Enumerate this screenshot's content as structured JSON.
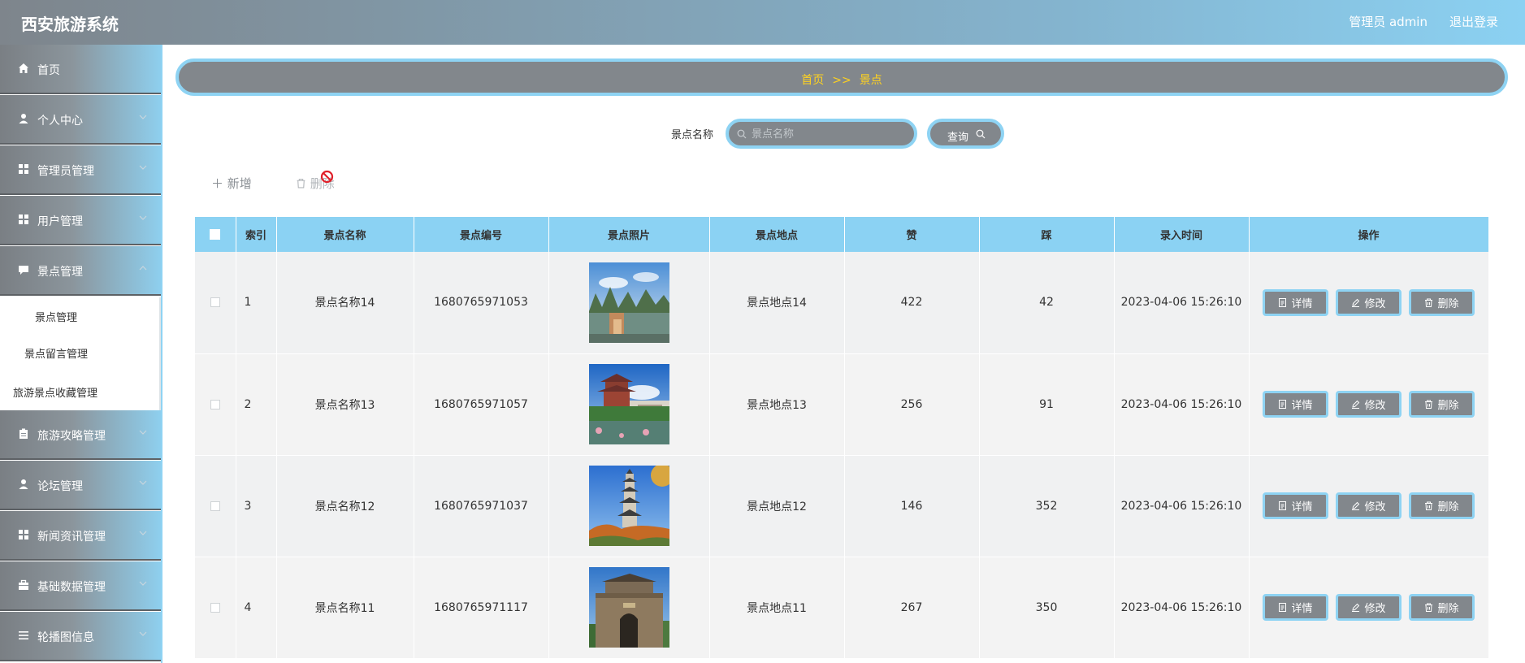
{
  "header": {
    "title": "西安旅游系统",
    "admin_label": "管理员 admin",
    "logout": "退出登录"
  },
  "sidebar": {
    "items": [
      {
        "label": "首页",
        "icon": "home-icon"
      },
      {
        "label": "个人中心",
        "icon": "user-icon"
      },
      {
        "label": "管理员管理",
        "icon": "grid-icon"
      },
      {
        "label": "用户管理",
        "icon": "grid-icon"
      },
      {
        "label": "景点管理",
        "icon": "comment-icon"
      },
      {
        "label": "旅游攻略管理",
        "icon": "clipboard-icon"
      },
      {
        "label": "论坛管理",
        "icon": "user-icon"
      },
      {
        "label": "新闻资讯管理",
        "icon": "grid-icon"
      },
      {
        "label": "基础数据管理",
        "icon": "briefcase-icon"
      },
      {
        "label": "轮播图信息",
        "icon": "menu-icon"
      }
    ],
    "submenu": [
      "景点管理",
      "景点留言管理",
      "旅游景点收藏管理"
    ]
  },
  "breadcrumb": {
    "home": "首页",
    "separator": ">>",
    "current": "景点"
  },
  "search": {
    "label": "景点名称",
    "placeholder": "景点名称",
    "button": "查询"
  },
  "actions": {
    "add": "新增",
    "delete": "删除"
  },
  "table": {
    "headers": [
      "索引",
      "景点名称",
      "景点编号",
      "景点照片",
      "景点地点",
      "赞",
      "踩",
      "录入时间",
      "操作"
    ],
    "op_labels": {
      "detail": "详情",
      "edit": "修改",
      "delete": "删除"
    },
    "rows": [
      {
        "index": "1",
        "name": "景点名称14",
        "code": "1680765971053",
        "photo": "mountain-lake-photo",
        "location": "景点地点14",
        "likes": "422",
        "dislikes": "42",
        "time": "2023-04-06 15:26:10"
      },
      {
        "index": "2",
        "name": "景点名称13",
        "code": "1680765971057",
        "photo": "pavilion-garden-photo",
        "location": "景点地点13",
        "likes": "256",
        "dislikes": "91",
        "time": "2023-04-06 15:26:10"
      },
      {
        "index": "3",
        "name": "景点名称12",
        "code": "1680765971037",
        "photo": "pagoda-photo",
        "location": "景点地点12",
        "likes": "146",
        "dislikes": "352",
        "time": "2023-04-06 15:26:10"
      },
      {
        "index": "4",
        "name": "景点名称11",
        "code": "1680765971117",
        "photo": "city-gate-photo",
        "location": "景点地点11",
        "likes": "267",
        "dislikes": "350",
        "time": "2023-04-06 15:26:10"
      }
    ]
  },
  "colors": {
    "accent": "#8ed3f3",
    "button_gray": "#82878c",
    "breadcrumb_text": "#ffd21f"
  }
}
